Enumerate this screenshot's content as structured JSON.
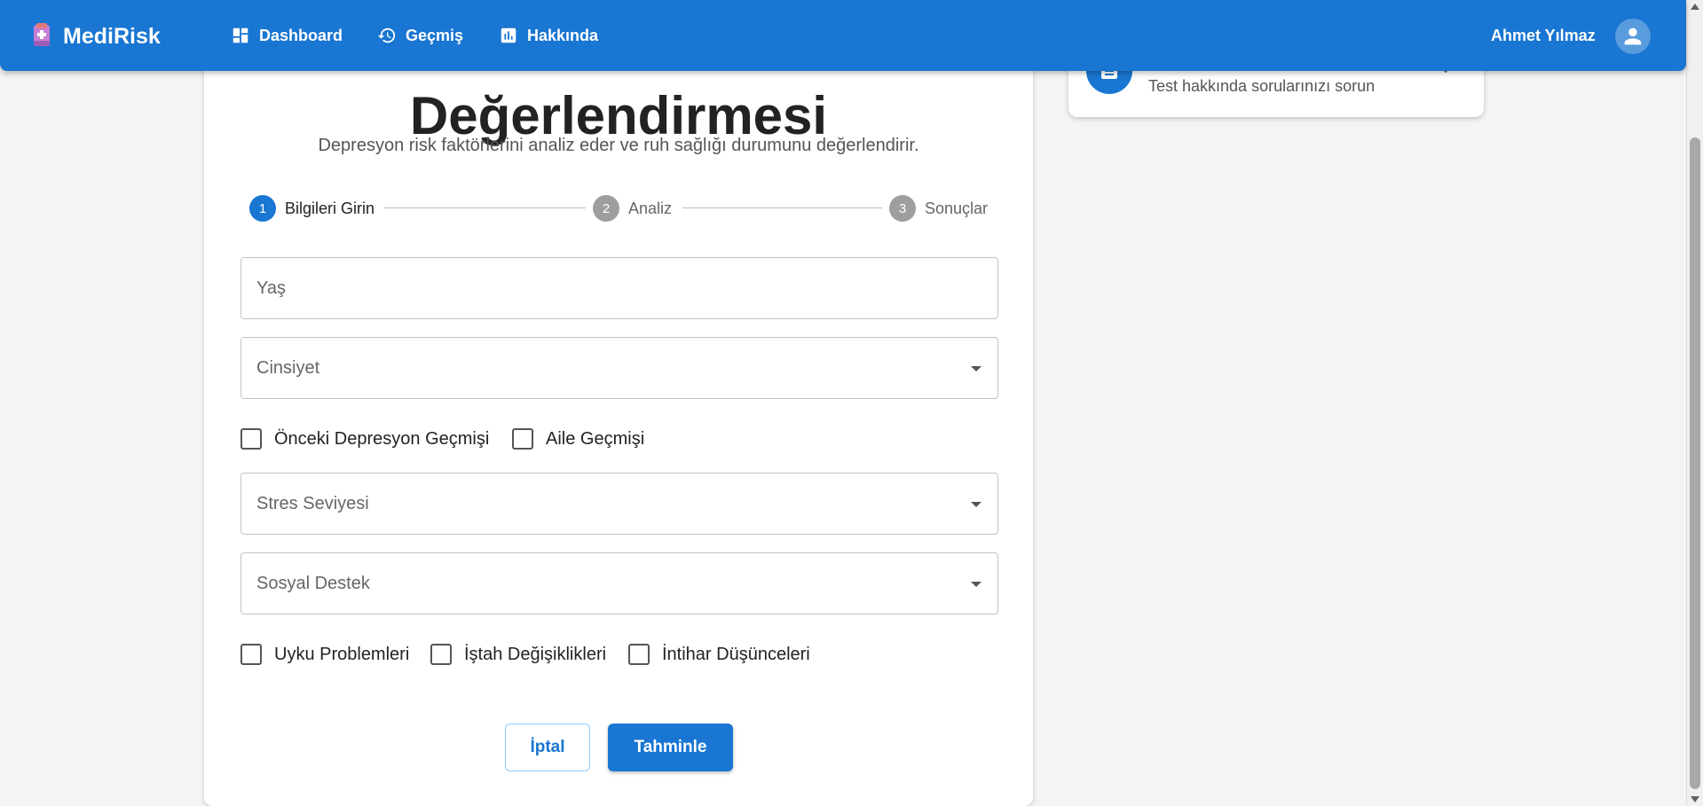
{
  "app": {
    "brand": "MediRisk",
    "user_name": "Ahmet Yılmaz"
  },
  "nav": [
    {
      "label": "Dashboard",
      "icon": "dashboard-icon"
    },
    {
      "label": "Geçmiş",
      "icon": "history-icon"
    },
    {
      "label": "Hakkında",
      "icon": "chart-icon"
    }
  ],
  "form": {
    "title": "Değerlendirmesi",
    "subtitle": "Depresyon risk faktörlerini analiz eder ve ruh sağlığı durumunu değerlendirir.",
    "steps": [
      {
        "number": "1",
        "label": "Bilgileri Girin",
        "active": true
      },
      {
        "number": "2",
        "label": "Analiz",
        "active": false
      },
      {
        "number": "3",
        "label": "Sonuçlar",
        "active": false
      }
    ],
    "fields": {
      "age": {
        "label": "Yaş",
        "value": ""
      },
      "gender": {
        "label": "Cinsiyet",
        "value": ""
      },
      "stress": {
        "label": "Stres Seviyesi",
        "value": ""
      },
      "social": {
        "label": "Sosyal Destek",
        "value": ""
      }
    },
    "checkboxes": {
      "prev_depression": {
        "label": "Önceki Depresyon Geçmişi",
        "checked": false
      },
      "family_history": {
        "label": "Aile Geçmişi",
        "checked": false
      },
      "sleep": {
        "label": "Uyku Problemleri",
        "checked": false
      },
      "appetite": {
        "label": "İştah Değişiklikleri",
        "checked": false
      },
      "suicidal": {
        "label": "İntihar Düşünceleri",
        "checked": false
      }
    },
    "buttons": {
      "cancel": "İptal",
      "submit": "Tahminle"
    }
  },
  "side_card": {
    "text": "Test hakkında sorularınızı sorun"
  },
  "colors": {
    "primary": "#1976d2",
    "step_inactive": "#9e9e9e"
  }
}
